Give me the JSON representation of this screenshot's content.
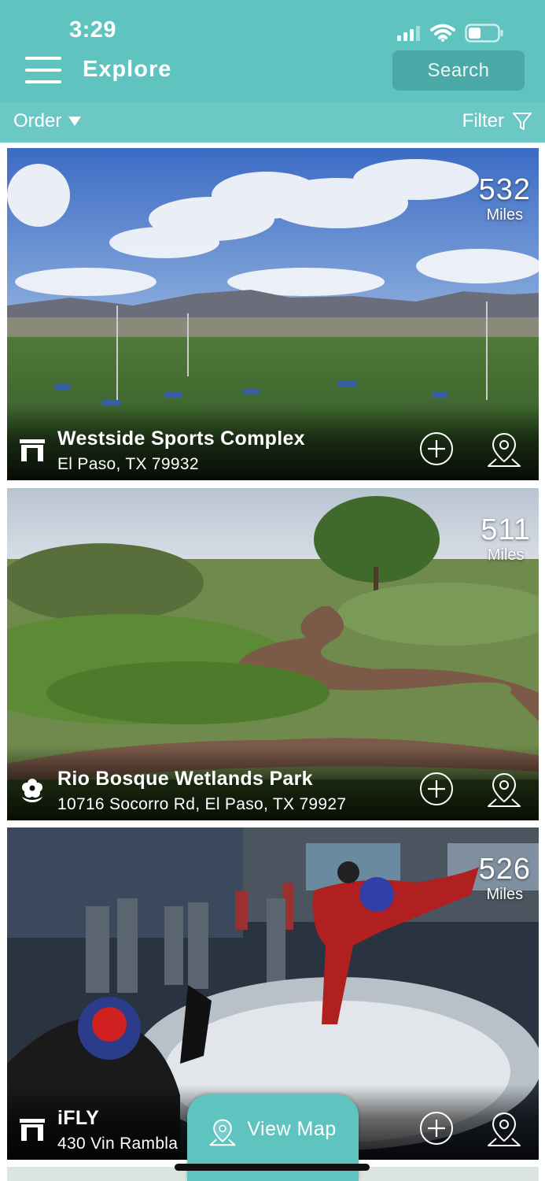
{
  "status_bar": {
    "time": "3:29"
  },
  "header": {
    "title": "Explore",
    "search_label": "Search"
  },
  "subbar": {
    "order_label": "Order",
    "filter_label": "Filter"
  },
  "places": [
    {
      "name": "Westside Sports Complex",
      "address": "El Paso, TX 79932",
      "distance": "532",
      "unit": "Miles",
      "category_icon": "arch-icon"
    },
    {
      "name": "Rio Bosque Wetlands Park",
      "address": "10716 Socorro Rd, El Paso, TX 79927",
      "distance": "511",
      "unit": "Miles",
      "category_icon": "flower-icon"
    },
    {
      "name": "iFLY",
      "address": "430 Vin Rambla",
      "distance": "526",
      "unit": "Miles",
      "category_icon": "arch-icon"
    }
  ],
  "view_map_label": "View Map",
  "colors": {
    "accent": "#5fc4c0",
    "accent_dark": "#4aa9a6"
  }
}
